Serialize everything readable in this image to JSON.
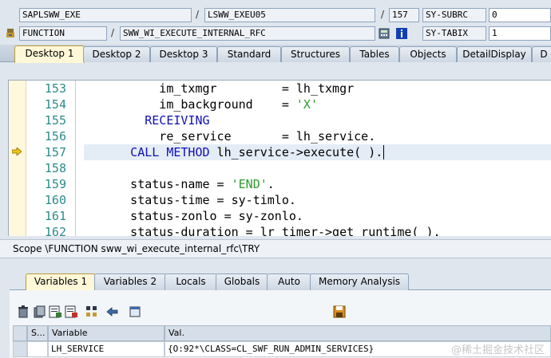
{
  "info_row1": {
    "program": "SAPLSWW_EXE",
    "include": "LSWW_EXEU05",
    "line": "157",
    "var_label": "SY-SUBRC",
    "var_value": "0"
  },
  "info_row2": {
    "type": "FUNCTION",
    "name": "SWW_WI_EXECUTE_INTERNAL_RFC",
    "var_label": "SY-TABIX",
    "var_value": "1"
  },
  "desktop_tabs": [
    "Desktop 1",
    "Desktop 2",
    "Desktop 3",
    "Standard",
    "Structures",
    "Tables",
    "Objects",
    "DetailDisplay",
    "D"
  ],
  "code_lines": [
    {
      "num": "153",
      "code": "          im_txmgr         = lh_txmgr"
    },
    {
      "num": "154",
      "code": "          im_background    = ",
      "str": "'X'"
    },
    {
      "num": "155",
      "kw": "        RECEIVING"
    },
    {
      "num": "156",
      "code": "          re_service       = lh_service."
    },
    {
      "num": "157",
      "kw": "      CALL METHOD",
      "code": " lh_service->execute( )."
    },
    {
      "num": "158",
      "code": ""
    },
    {
      "num": "159",
      "code": "      status-name = ",
      "str": "'END'",
      "tail": "."
    },
    {
      "num": "160",
      "code": "      status-time = sy-timlo."
    },
    {
      "num": "161",
      "code": "      status-zonlo = sy-zonlo."
    },
    {
      "num": "162",
      "code": "      status-duration = lr_timer->get_runtime( )."
    }
  ],
  "scope": "Scope \\FUNCTION sww_wi_execute_internal_rfc\\TRY",
  "bottom_tabs": [
    "Variables 1",
    "Variables 2",
    "Locals",
    "Globals",
    "Auto",
    "Memory Analysis"
  ],
  "var_table": {
    "headers": [
      "S...",
      "Variable",
      "Val."
    ],
    "rows": [
      {
        "s": "",
        "variable": "LH_SERVICE",
        "value": "{O:92*\\CLASS=CL_SWF_RUN_ADMIN_SERVICES}"
      }
    ]
  },
  "watermark": "@稀土掘金技术社区"
}
